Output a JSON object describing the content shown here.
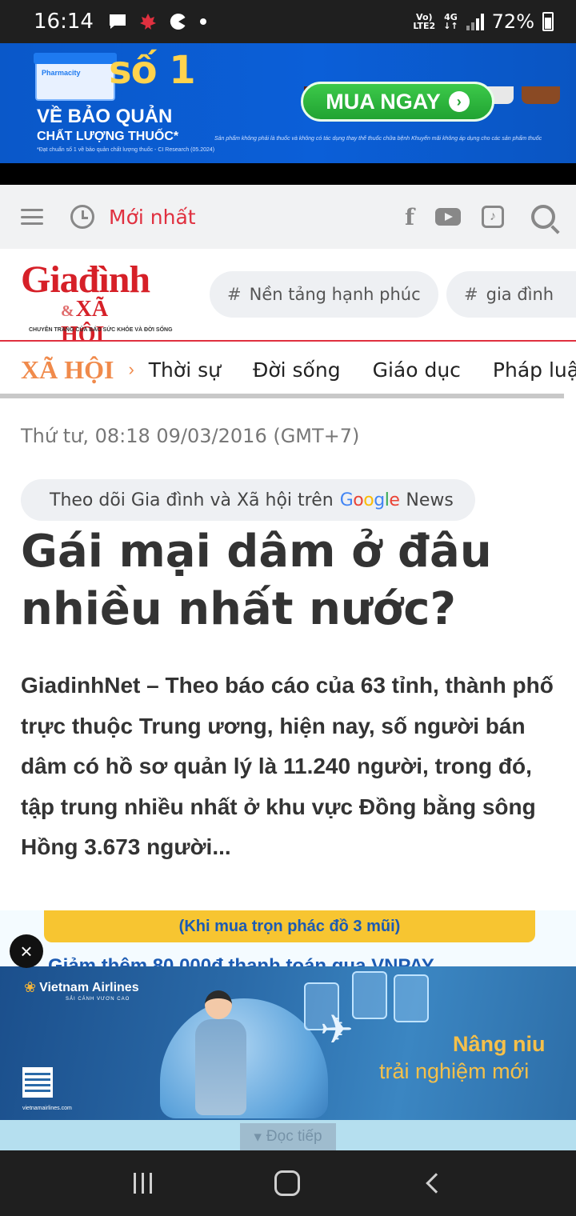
{
  "status_bar": {
    "time": "16:14",
    "network_top": "Vo)",
    "network_bottom": "LTE2",
    "network_type": "4G",
    "battery": "72%"
  },
  "top_ad": {
    "store_label": "Pharmacity",
    "badge": "số 1",
    "line1": "VỀ BẢO QUẢN",
    "line2": "CHẤT LƯỢNG THUỐC*",
    "fine_print": "*Đạt chuẩn số 1 về bảo quản chất lượng thuốc - CI Research (05.2024)",
    "cta": "MUA NGAY",
    "disclaimer": "Sản phẩm không phải là thuốc và không có tác dụng thay thế thuốc chữa bệnh Khuyến mãi không áp dụng cho các sản phẩm thuốc"
  },
  "toolbar": {
    "latest_label": "Mới nhất",
    "facebook_glyph": "f",
    "tiktok_glyph": "♪"
  },
  "logo": {
    "main": "Giađình",
    "amp": "&",
    "sub": "XÃ HỘI",
    "tagline": "CHUYÊN TRANG CỦA BÁO SỨC KHỎE VÀ ĐỜI SỐNG"
  },
  "tags": [
    {
      "hash": "#",
      "label": "Nền tảng hạnh phúc"
    },
    {
      "hash": "#",
      "label": "gia đình"
    }
  ],
  "category_nav": {
    "section": "XÃ HỘI",
    "arrow": "›",
    "items": [
      "Thời sự",
      "Đời sống",
      "Giáo dục",
      "Pháp luật"
    ]
  },
  "article": {
    "date": "Thứ tư, 08:18 09/03/2016 (GMT+7)",
    "follow_text": "Theo dõi Gia đình và Xã hội trên",
    "google": [
      "G",
      "o",
      "o",
      "g",
      "l",
      "e"
    ],
    "news": "News",
    "title": "Gái mại dâm ở đâu nhiều nhất nước?",
    "lead": "GiadinhNet – Theo báo cáo của 63 tỉnh, thành phố trực thuộc Trung ương, hiện nay, số người bán dâm có hồ sơ quản lý là 11.240 người, trong đó, tập trung nhiều nhất ở khu vực Đồng bằng sông Hồng 3.673 người..."
  },
  "under_ad": {
    "bar_text": "(Khi mua trọn phác đồ 3 mũi)",
    "partial_text": "Giảm thêm 80.000đ thanh toán qua VNPAY"
  },
  "close_glyph": "×",
  "va_ad": {
    "brand": "Vietnam Airlines",
    "slogan": "SẢI CÁNH VƯƠN CAO",
    "url": "vietnamairlines.com",
    "tagline1": "Nâng niu",
    "tagline2": "trải nghiệm mới",
    "plane_glyph": "✈",
    "lotus_glyph": "❀"
  },
  "read_more": {
    "arrow": "▾",
    "label": "Đọc tiếp"
  },
  "colors": {
    "accent_red": "#e0303f",
    "section_orange": "#f08a4b",
    "ad_blue": "#0b5fd8",
    "cta_green": "#21a332"
  }
}
